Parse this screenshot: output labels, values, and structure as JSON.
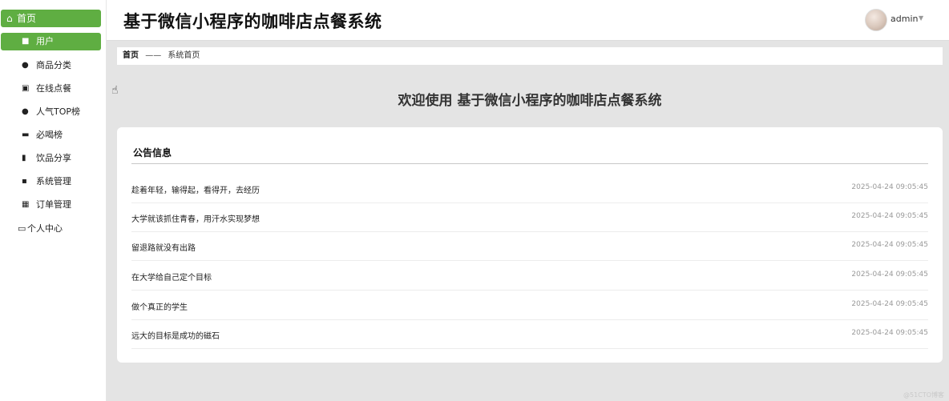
{
  "sidebar": {
    "home_label": "首页",
    "items": [
      {
        "label": "用户",
        "icon": "briefcase-icon",
        "glyph": "💼",
        "active": true
      },
      {
        "label": "商品分类",
        "icon": "user-icon",
        "glyph": "👤",
        "active": false
      },
      {
        "label": "在线点餐",
        "icon": "clipboard-icon",
        "glyph": "▣",
        "active": false
      },
      {
        "label": "人气TOP榜",
        "icon": "user-icon",
        "glyph": "👤",
        "active": false
      },
      {
        "label": "必喝榜",
        "icon": "comment-icon",
        "glyph": "▬",
        "active": false
      },
      {
        "label": "饮品分享",
        "icon": "chart-icon",
        "glyph": "▮",
        "active": false
      },
      {
        "label": "系统管理",
        "icon": "ticket-icon",
        "glyph": "▪",
        "active": false
      },
      {
        "label": "订单管理",
        "icon": "grid-icon",
        "glyph": "▦",
        "active": false
      }
    ],
    "personal_label": "个人中心"
  },
  "header": {
    "title": "基于微信小程序的咖啡店点餐系统",
    "user_name": "admin"
  },
  "breadcrumb": {
    "home": "首页",
    "separator": "——",
    "current": "系统首页"
  },
  "welcome_text": "欢迎使用 基于微信小程序的咖啡店点餐系统",
  "notice": {
    "title": "公告信息",
    "rows": [
      {
        "title": "趁着年轻，输得起，看得开，去经历",
        "time": "2025-04-24 09:05:45"
      },
      {
        "title": "大学就该抓住青春，用汗水实现梦想",
        "time": "2025-04-24 09:05:45"
      },
      {
        "title": "留退路就没有出路",
        "time": "2025-04-24 09:05:45"
      },
      {
        "title": "在大学给自己定个目标",
        "time": "2025-04-24 09:05:45"
      },
      {
        "title": "做个真正的学生",
        "time": "2025-04-24 09:05:45"
      },
      {
        "title": "远大的目标是成功的磁石",
        "time": "2025-04-24 09:05:45"
      }
    ]
  },
  "watermark": "@51CTO博客",
  "colors": {
    "accent": "#5fae42",
    "background": "#e4e4e4"
  }
}
